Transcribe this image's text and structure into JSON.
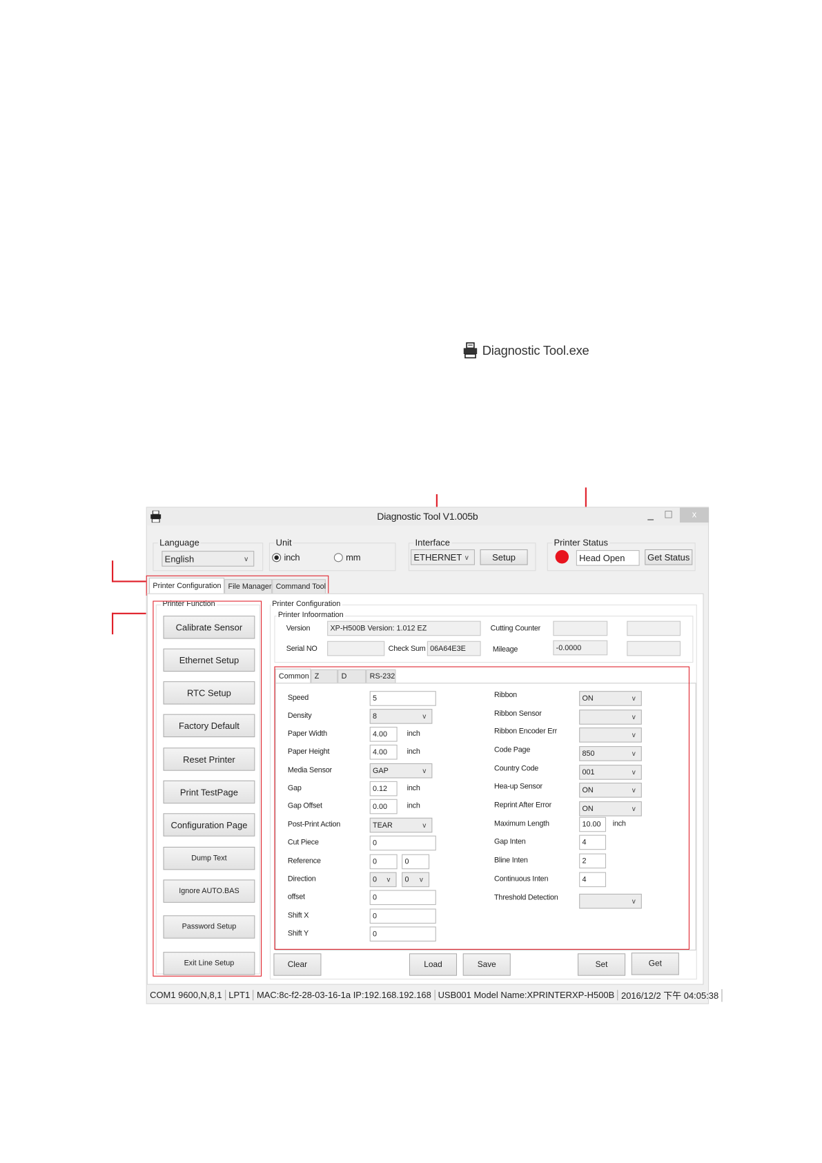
{
  "desktop_icon": {
    "label": "Diagnostic Tool.exe",
    "icon": "printer-icon"
  },
  "window": {
    "title": "Diagnostic Tool V1.005b",
    "minimize": "_",
    "maximize": "☐",
    "close": "x"
  },
  "language": {
    "label": "Language",
    "value": "English"
  },
  "unit": {
    "label": "Unit",
    "options": [
      "inch",
      "mm"
    ],
    "selected": "inch"
  },
  "interface": {
    "label": "Interface",
    "value": "ETHERNET",
    "setup": "Setup"
  },
  "printer_status": {
    "label": "Printer  Status",
    "value": "Head Open",
    "get_status": "Get Status",
    "indicator_color": "#e8141e"
  },
  "tabs": [
    "Printer Configuration",
    "File Manager",
    "Command Tool"
  ],
  "printer_function": {
    "label": "Printer  Function",
    "buttons": [
      "Calibrate Sensor",
      "Ethernet Setup",
      "RTC Setup",
      "Factory Default",
      "Reset Printer",
      "Print TestPage",
      "Configuration Page",
      "Dump Text",
      "Ignore AUTO.BAS",
      "Password Setup",
      "Exit Line Setup"
    ]
  },
  "config": {
    "label": "Printer Configuration",
    "info_label": "Printer Infoormation",
    "version_label": "Version",
    "version": "XP-H500B Version: 1.012 EZ",
    "cutting_label": "Cutting Counter",
    "cutting": "",
    "serial_label": "Serial NO",
    "serial": "",
    "checksum_label": "Check Sum",
    "checksum": "06A64E3E",
    "mileage_label": "Mileage",
    "mileage": "-0.0000"
  },
  "subtabs": [
    "Common",
    "Z",
    "D",
    "RS-232"
  ],
  "unit_text": "inch",
  "left_rows": [
    {
      "label": "Speed",
      "type": "text",
      "value": "5"
    },
    {
      "label": "Density",
      "type": "select",
      "value": "8"
    },
    {
      "label": "Paper Width",
      "type": "short",
      "value": "4.00",
      "unit": "inch"
    },
    {
      "label": "Paper Height",
      "type": "short",
      "value": "4.00",
      "unit": "inch"
    },
    {
      "label": "Media Sensor",
      "type": "select",
      "value": "GAP"
    },
    {
      "label": "Gap",
      "type": "short",
      "value": "0.12",
      "unit": "inch"
    },
    {
      "label": "Gap Offset",
      "type": "short",
      "value": "0.00",
      "unit": "inch"
    },
    {
      "label": "Post-Print  Action",
      "type": "select",
      "value": "TEAR"
    },
    {
      "label": "Cut  Piece",
      "type": "text",
      "value": "0"
    },
    {
      "label": "Reference",
      "type": "pair",
      "value": "0",
      "value2": "0"
    },
    {
      "label": "Direction",
      "type": "selpair",
      "value": "0",
      "value2": "0"
    },
    {
      "label": "offset",
      "type": "text",
      "value": "0"
    },
    {
      "label": "Shift X",
      "type": "text",
      "value": "0"
    },
    {
      "label": "Shift Y",
      "type": "text",
      "value": "0"
    }
  ],
  "right_rows": [
    {
      "label": "Ribbon",
      "type": "select",
      "value": "ON"
    },
    {
      "label": "Ribbon  Sensor",
      "type": "select",
      "value": ""
    },
    {
      "label": "Ribbon Encoder Err",
      "type": "select",
      "value": ""
    },
    {
      "label": "Code Page",
      "type": "select",
      "value": "850"
    },
    {
      "label": "Country Code",
      "type": "select",
      "value": "001"
    },
    {
      "label": "Hea-up  Sensor",
      "type": "select",
      "value": "ON"
    },
    {
      "label": "Reprint After  Error",
      "type": "select",
      "value": "ON"
    },
    {
      "label": "Maximum Length",
      "type": "short",
      "value": "10.00",
      "unit": "inch"
    },
    {
      "label": "Gap Inten",
      "type": "short",
      "value": "4"
    },
    {
      "label": "Bline  Inten",
      "type": "short",
      "value": "2"
    },
    {
      "label": "Continuous  Inten",
      "type": "short",
      "value": "4"
    },
    {
      "label": "Threshold  Detection",
      "type": "select",
      "value": ""
    }
  ],
  "actions": {
    "clear": "Clear",
    "load": "Load",
    "save": "Save",
    "set": "Set",
    "get": "Get"
  },
  "statusbar": [
    "COM1 9600,N,8,1",
    "LPT1",
    "MAC:8c-f2-28-03-16-1a  IP:192.168.192.168",
    "USB001  Model Name:XPRINTERXP-H500B",
    "2016/12/2 下午 04:05:38"
  ]
}
